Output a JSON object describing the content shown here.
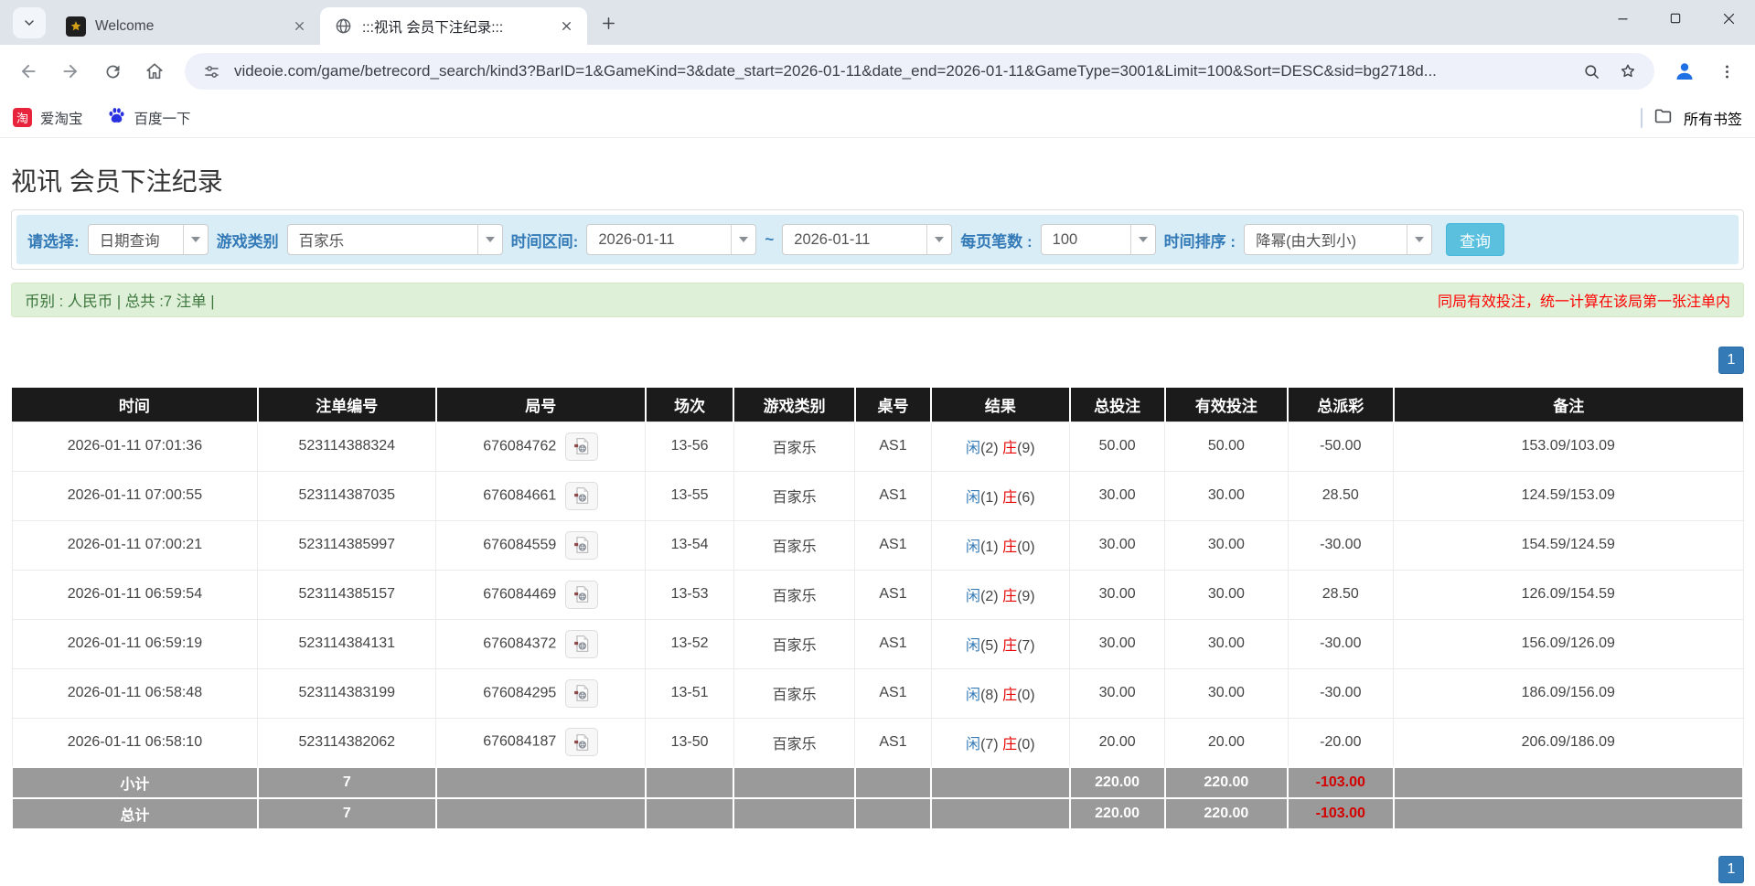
{
  "colors": {
    "accent_blue": "#337ab7",
    "search_button_cyan": "#5bc0de",
    "filter_bar_bg": "#d9edf7",
    "summary_bg": "#dff0d8",
    "summary_text": "#3c763d",
    "alert_red": "#ff0000",
    "negative_red": "#e60000",
    "table_header_bg": "#1b1b1b",
    "sum_row_bg": "#9a9a9a"
  },
  "icons": {
    "tab_search": "chevron-down",
    "welcome_favicon": "dark-gold-crest",
    "active_tab_favicon": "globe",
    "tab_close": "x-cross",
    "new_tab": "plus",
    "minimize": "horizontal-line",
    "maximize": "square-outline",
    "window_close": "x-cross",
    "back": "arrow-left",
    "forward": "arrow-right",
    "reload": "circular-arrow",
    "home": "house",
    "site_info": "tune-sliders",
    "page_zoom": "magnifier",
    "bookmark_star": "star-outline",
    "profile": "person-blue",
    "menu": "three-dots-vertical",
    "taobao_badge_char": "淘",
    "baidu": "blue-paw",
    "all_bookmarks": "folder-outline",
    "select_arrow": "triangle-down",
    "video_replay": "film-clip"
  },
  "browser": {
    "tabs": [
      {
        "title": "Welcome"
      },
      {
        "title": ":::视讯 会员下注纪录:::"
      }
    ],
    "url": "videoie.com/game/betrecord_search/kind3?BarID=1&GameKind=3&date_start=2026-01-11&date_end=2026-01-11&GameType=3001&Limit=100&Sort=DESC&sid=bg2718d...",
    "bookmarks": [
      {
        "label": "爱淘宝"
      },
      {
        "label": "百度一下"
      }
    ],
    "all_bookmarks_label": "所有书签"
  },
  "page": {
    "title": "视讯 会员下注纪录",
    "filters": {
      "choose_label": "请选择:",
      "choose_value": "日期查询",
      "game_kind_label": "游戏类别",
      "game_kind_value": "百家乐",
      "date_range_label": "时间区间:",
      "date_start": "2026-01-11",
      "range_separator": "~",
      "date_end": "2026-01-11",
      "per_page_label": "每页笔数 :",
      "per_page_value": "100",
      "sort_label": "时间排序 :",
      "sort_value": "降幂(由大到小)",
      "search_button": "查询"
    },
    "summary_left": "币别 : 人民币 | 总共 :7 注单 |",
    "summary_right": "同局有效投注，统一计算在该局第一张注单内",
    "pagination": "1",
    "table": {
      "headers": [
        "时间",
        "注单编号",
        "局号",
        "场次",
        "游戏类别",
        "桌号",
        "结果",
        "总投注",
        "有效投注",
        "总派彩",
        "备注"
      ],
      "col_widths": [
        "14.2%",
        "10.3%",
        "12.1%",
        "5.1%",
        "7.0%",
        "4.4%",
        "8.0%",
        "5.5%",
        "7.1%",
        "6.1%",
        "20.2%"
      ],
      "rows": [
        {
          "time": "2026-01-11 07:01:36",
          "bet_no": "523114388324",
          "round_no": "676084762",
          "session": "13-56",
          "game": "百家乐",
          "table_no": "AS1",
          "result": {
            "player": "闲",
            "player_score": "(2)",
            "banker": "庄",
            "banker_score": "(9)"
          },
          "total_bet": "50.00",
          "valid_bet": "50.00",
          "payout": "-50.00",
          "remark": "153.09/103.09"
        },
        {
          "time": "2026-01-11 07:00:55",
          "bet_no": "523114387035",
          "round_no": "676084661",
          "session": "13-55",
          "game": "百家乐",
          "table_no": "AS1",
          "result": {
            "player": "闲",
            "player_score": "(1)",
            "banker": "庄",
            "banker_score": "(6)"
          },
          "total_bet": "30.00",
          "valid_bet": "30.00",
          "payout": "28.50",
          "remark": "124.59/153.09"
        },
        {
          "time": "2026-01-11 07:00:21",
          "bet_no": "523114385997",
          "round_no": "676084559",
          "session": "13-54",
          "game": "百家乐",
          "table_no": "AS1",
          "result": {
            "player": "闲",
            "player_score": "(1)",
            "banker": "庄",
            "banker_score": "(0)"
          },
          "total_bet": "30.00",
          "valid_bet": "30.00",
          "payout": "-30.00",
          "remark": "154.59/124.59"
        },
        {
          "time": "2026-01-11 06:59:54",
          "bet_no": "523114385157",
          "round_no": "676084469",
          "session": "13-53",
          "game": "百家乐",
          "table_no": "AS1",
          "result": {
            "player": "闲",
            "player_score": "(2)",
            "banker": "庄",
            "banker_score": "(9)"
          },
          "total_bet": "30.00",
          "valid_bet": "30.00",
          "payout": "28.50",
          "remark": "126.09/154.59"
        },
        {
          "time": "2026-01-11 06:59:19",
          "bet_no": "523114384131",
          "round_no": "676084372",
          "session": "13-52",
          "game": "百家乐",
          "table_no": "AS1",
          "result": {
            "player": "闲",
            "player_score": "(5)",
            "banker": "庄",
            "banker_score": "(7)"
          },
          "total_bet": "30.00",
          "valid_bet": "30.00",
          "payout": "-30.00",
          "remark": "156.09/126.09"
        },
        {
          "time": "2026-01-11 06:58:48",
          "bet_no": "523114383199",
          "round_no": "676084295",
          "session": "13-51",
          "game": "百家乐",
          "table_no": "AS1",
          "result": {
            "player": "闲",
            "player_score": "(8)",
            "banker": "庄",
            "banker_score": "(0)"
          },
          "total_bet": "30.00",
          "valid_bet": "30.00",
          "payout": "-30.00",
          "remark": "186.09/156.09"
        },
        {
          "time": "2026-01-11 06:58:10",
          "bet_no": "523114382062",
          "round_no": "676084187",
          "session": "13-50",
          "game": "百家乐",
          "table_no": "AS1",
          "result": {
            "player": "闲",
            "player_score": "(7)",
            "banker": "庄",
            "banker_score": "(0)"
          },
          "total_bet": "20.00",
          "valid_bet": "20.00",
          "payout": "-20.00",
          "remark": "206.09/186.09"
        }
      ],
      "subtotal": {
        "label": "小计",
        "count": "7",
        "total_bet": "220.00",
        "valid_bet": "220.00",
        "payout": "-103.00"
      },
      "total": {
        "label": "总计",
        "count": "7",
        "total_bet": "220.00",
        "valid_bet": "220.00",
        "payout": "-103.00"
      }
    }
  }
}
